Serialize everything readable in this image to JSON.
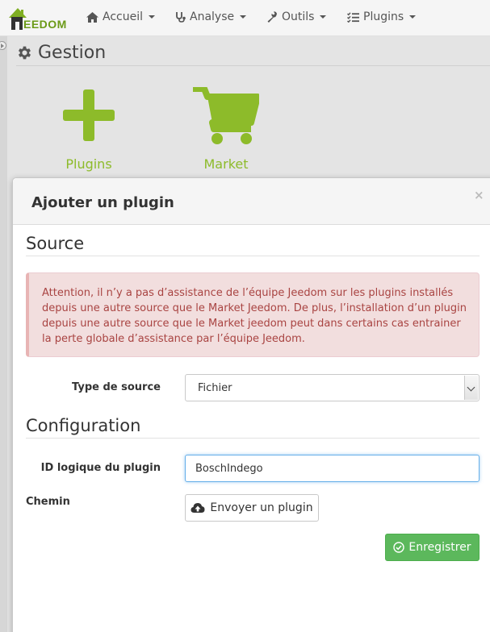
{
  "navbar": {
    "logo_text": "EEDOM",
    "menus": [
      {
        "label": "Accueil",
        "icon": "home-icon"
      },
      {
        "label": "Analyse",
        "icon": "stethoscope-icon"
      },
      {
        "label": "Outils",
        "icon": "wrench-icon"
      },
      {
        "label": "Plugins",
        "icon": "tasks-icon"
      }
    ]
  },
  "page": {
    "title": "Gestion",
    "title_icon": "gear-icon",
    "tiles": [
      {
        "label": "Plugins",
        "icon": "plus-icon"
      },
      {
        "label": "Market",
        "icon": "shopping-cart-icon"
      }
    ]
  },
  "modal": {
    "title": "Ajouter un plugin",
    "close_label": "×",
    "source_section": {
      "title": "Source",
      "alert": "Attention, il n’y a pas d’assistance de l’équipe Jeedom sur les plugins installés depuis une autre source que le Market Jeedom. De plus, l’installation d’un plugin depuis une autre source que le Market jeedom peut dans certains cas entrainer la perte globale d’assistance par l’équipe Jeedom.",
      "type_label": "Type de source",
      "type_value": "Fichier"
    },
    "config_section": {
      "title": "Configuration",
      "id_label": "ID logique du plugin",
      "id_value": "BoschIndego",
      "path_label": "Chemin",
      "upload_label": "Envoyer un plugin"
    },
    "save_label": "Enregistrer"
  },
  "colors": {
    "brand_green": "#8dbb2a",
    "success": "#5cb85c",
    "danger_bg": "#f2dede",
    "danger_text": "#a94442"
  }
}
